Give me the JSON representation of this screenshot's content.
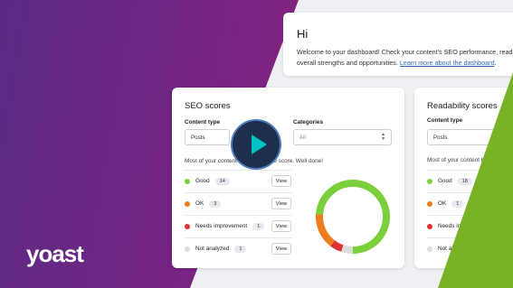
{
  "welcome": {
    "title": "Hi",
    "text_line1": "Welcome to your dashboard! Check your content's SEO performance, readabilit",
    "text_line2": "overall strengths and opportunities. ",
    "link": "Learn more about the dashboard",
    "link_after": "."
  },
  "seo_card": {
    "title": "SEO scores",
    "content_type_label": "Content type",
    "content_type_value": "Posts",
    "categories_label": "Categories",
    "categories_value": "All",
    "description_left": "Most of your content",
    "description_right": "O score. Well done!",
    "view_label": "View",
    "rows": [
      {
        "label": "Good",
        "count": "14",
        "color": "#7ad03a"
      },
      {
        "label": "OK",
        "count": "3",
        "color": "#ee7c1b"
      },
      {
        "label": "Needs improvement",
        "count": "1",
        "color": "#dc3232"
      },
      {
        "label": "Not analyzed",
        "count": "1",
        "color": "#dcdcde"
      }
    ],
    "donut_values": [
      14,
      3,
      1,
      1
    ]
  },
  "readability_card": {
    "title": "Readability scores",
    "content_type_label": "Content type",
    "content_type_value": "Posts",
    "description": "Most of your content h",
    "rows": [
      {
        "label": "Good",
        "count": "18",
        "color": "#7ad03a"
      },
      {
        "label": "OK",
        "count": "1",
        "color": "#ee7c1b"
      },
      {
        "label": "Needs im",
        "color": "#dc3232"
      },
      {
        "label": "Not ana",
        "color": "#dcdcde"
      }
    ]
  },
  "brand": {
    "logo": "yoast",
    "green": "#77b227",
    "purple": "#7a2382"
  }
}
